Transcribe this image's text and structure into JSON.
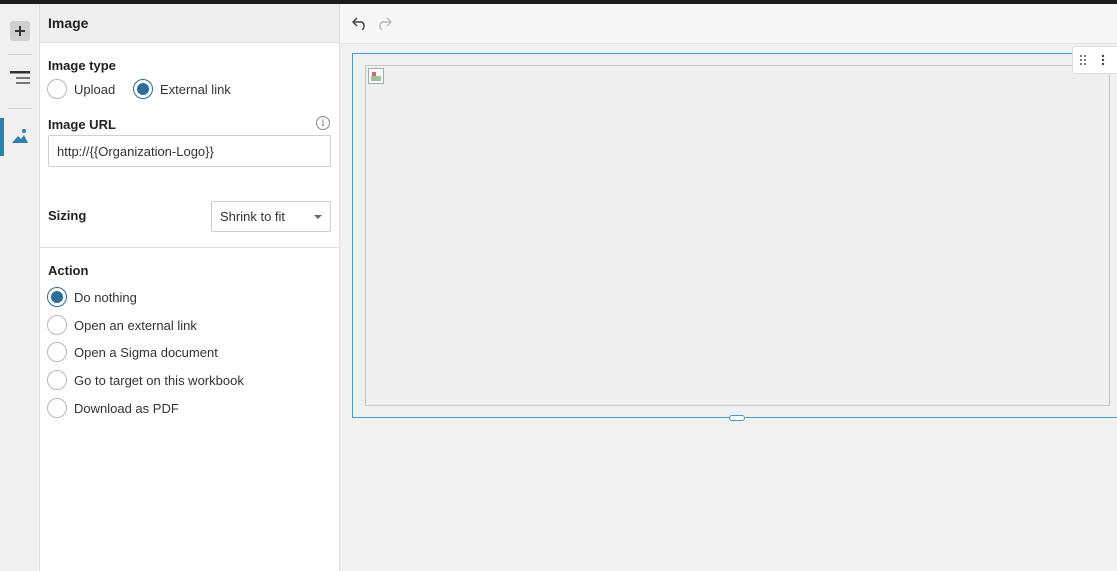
{
  "panel": {
    "title": "Image",
    "image_type": {
      "label": "Image type",
      "options": [
        {
          "label": "Upload",
          "checked": false
        },
        {
          "label": "External link",
          "checked": true
        }
      ]
    },
    "image_url": {
      "label": "Image URL",
      "value": "http://{{Organization-Logo}}",
      "info_glyph": "i"
    },
    "sizing": {
      "label": "Sizing",
      "value": "Shrink to fit"
    },
    "action": {
      "label": "Action",
      "options": [
        {
          "label": "Do nothing",
          "checked": true
        },
        {
          "label": "Open an external link",
          "checked": false
        },
        {
          "label": "Open a Sigma document",
          "checked": false
        },
        {
          "label": "Go to target on this workbook",
          "checked": false
        },
        {
          "label": "Download as PDF",
          "checked": false
        }
      ]
    }
  },
  "rail": {
    "icons": [
      "plus-icon",
      "outline-icon",
      "image-icon"
    ]
  },
  "toolbar": {
    "icons": [
      "undo-icon",
      "redo-icon"
    ]
  },
  "colors": {
    "accent": "#2d6e98",
    "selection": "#4a9ac4",
    "topbar": "#1b1b1b"
  }
}
